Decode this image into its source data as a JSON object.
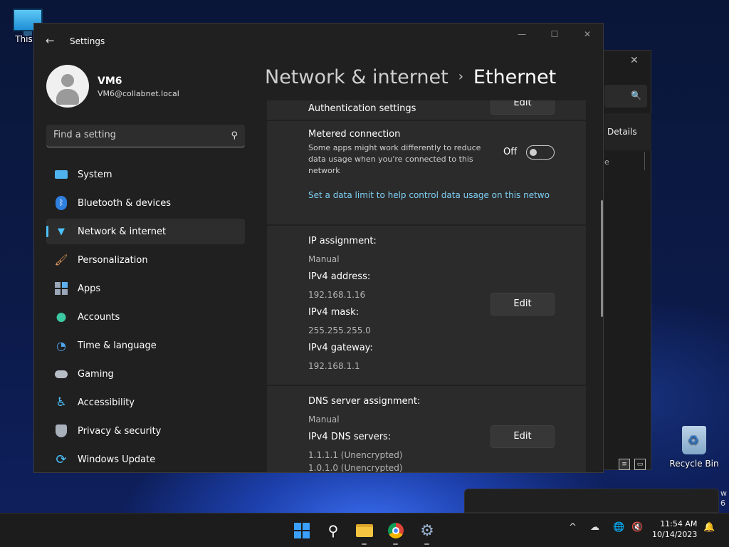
{
  "desktop": {
    "this_pc_label": "This P",
    "recycle_bin_label": "Recycle Bin",
    "edge_text_1": "w",
    "edge_text_2": "6"
  },
  "bg_window": {
    "close": "✕",
    "details_label": "Details",
    "partial_text": "e"
  },
  "window": {
    "title": "Settings"
  },
  "user": {
    "name": "VM6",
    "email": "VM6@collabnet.local"
  },
  "search": {
    "placeholder": "Find a setting"
  },
  "sidebar": {
    "items": [
      {
        "label": "System",
        "icon": "monitor-icon"
      },
      {
        "label": "Bluetooth & devices",
        "icon": "bluetooth-icon"
      },
      {
        "label": "Network & internet",
        "icon": "wifi-icon",
        "active": true
      },
      {
        "label": "Personalization",
        "icon": "brush-icon"
      },
      {
        "label": "Apps",
        "icon": "apps-icon"
      },
      {
        "label": "Accounts",
        "icon": "person-icon"
      },
      {
        "label": "Time & language",
        "icon": "globe-clock-icon"
      },
      {
        "label": "Gaming",
        "icon": "gamepad-icon"
      },
      {
        "label": "Accessibility",
        "icon": "accessibility-icon"
      },
      {
        "label": "Privacy & security",
        "icon": "shield-icon"
      },
      {
        "label": "Windows Update",
        "icon": "update-icon"
      }
    ]
  },
  "header": {
    "parent": "Network & internet",
    "separator": "›",
    "current": "Ethernet"
  },
  "auth": {
    "label": "Authentication settings",
    "button": "Edit"
  },
  "metered": {
    "label": "Metered connection",
    "description": "Some apps might work differently to reduce data usage when you're connected to this network",
    "state": "Off",
    "link": "Set a data limit to help control data usage on this netwo"
  },
  "ip": {
    "assignment_label": "IP assignment:",
    "assignment_value": "Manual",
    "ipv4_address_label": "IPv4 address:",
    "ipv4_address_value": "192.168.1.16",
    "ipv4_mask_label": "IPv4 mask:",
    "ipv4_mask_value": "255.255.255.0",
    "ipv4_gateway_label": "IPv4 gateway:",
    "ipv4_gateway_value": "192.168.1.1",
    "button": "Edit"
  },
  "dns": {
    "assignment_label": "DNS server assignment:",
    "assignment_value": "Manual",
    "servers_label": "IPv4 DNS servers:",
    "server_1": "1.1.1.1 (Unencrypted)",
    "server_2": "1.0.1.0 (Unencrypted)",
    "button": "Edit"
  },
  "taskbar": {
    "time": "11:54 AM",
    "date": "10/14/2023"
  },
  "colors": {
    "accent": "#4cc2ff",
    "link": "#7fd0f5",
    "window_bg": "#202020",
    "card_bg": "#2b2b2b"
  }
}
